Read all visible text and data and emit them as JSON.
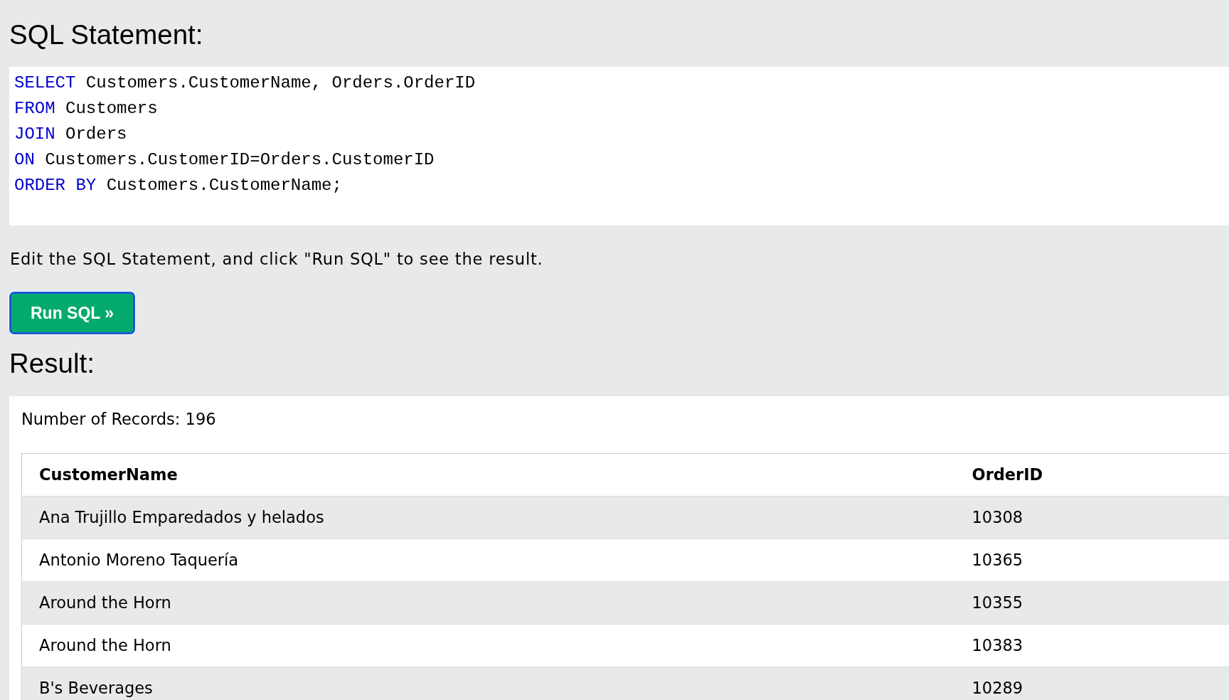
{
  "sql_heading": "SQL Statement:",
  "editor": {
    "lines": [
      [
        {
          "kind": "keyword",
          "text": "SELECT"
        },
        {
          "kind": "text",
          "text": "Customers.CustomerName, Orders.OrderID"
        }
      ],
      [
        {
          "kind": "keyword",
          "text": "FROM"
        },
        {
          "kind": "text",
          "text": "Customers"
        }
      ],
      [
        {
          "kind": "keyword",
          "text": "JOIN"
        },
        {
          "kind": "text",
          "text": "Orders"
        }
      ],
      [
        {
          "kind": "keyword",
          "text": "ON"
        },
        {
          "kind": "text",
          "text": "Customers.CustomerID=Orders.CustomerID"
        }
      ],
      [
        {
          "kind": "keyword",
          "text": "ORDER BY"
        },
        {
          "kind": "text",
          "text": "Customers.CustomerName;"
        }
      ]
    ]
  },
  "instruction": "Edit the SQL Statement, and click \"Run SQL\" to see the result.",
  "run_button": {
    "label": "Run SQL »",
    "focused": true
  },
  "result_heading": "Result:",
  "result": {
    "record_count": "Number of Records: 196",
    "table": {
      "columns": [
        "CustomerName",
        "OrderID"
      ],
      "rows": [
        [
          "Ana Trujillo Emparedados y helados",
          "10308"
        ],
        [
          "Antonio Moreno Taquería",
          "10365"
        ],
        [
          "Around the Horn",
          "10355"
        ],
        [
          "Around the Horn",
          "10383"
        ],
        [
          "B's Beverages",
          "10289"
        ]
      ]
    }
  }
}
